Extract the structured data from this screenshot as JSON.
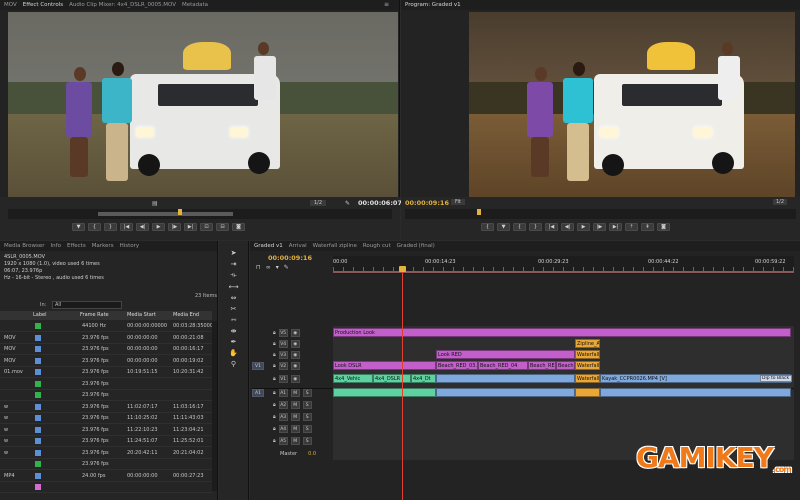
{
  "source_monitor": {
    "tabs": [
      "MOV",
      "Effect Controls",
      "Audio Clip Mixer: 4x4_DSLR_0005.MOV",
      "Metadata"
    ],
    "fit": "1/2",
    "timecode": "00:00:06:07"
  },
  "program_monitor": {
    "tab": "Program: Graded v1",
    "timecode": "00:00:09:16",
    "fit": "Fit",
    "zoom": "1/2"
  },
  "project": {
    "tabs": [
      "Media Browser",
      "Info",
      "Effects",
      "Markers",
      "History"
    ],
    "info_lines": [
      "4SLR_0005.MOV",
      "1920 x 1080 (1.0), video used 6 times",
      "06:07, 23.976p",
      "Hz - 16-bit - Stereo , audio used 6 times"
    ],
    "in_label": "In:",
    "in_value": "All",
    "item_count": "23 Items",
    "columns": [
      "Label",
      "Frame Rate",
      "Media Start",
      "Media End"
    ],
    "rows": [
      {
        "name": "",
        "color": "#2fb34a",
        "rate": "44100 Hz",
        "start": "00:00:00:00000",
        "end": "00:03:28:35000"
      },
      {
        "name": "MOV",
        "color": "#5b8fd6",
        "rate": "23.976 fps",
        "start": "00:00:00:00",
        "end": "00:00:21:08"
      },
      {
        "name": "MOV",
        "color": "#5b8fd6",
        "rate": "23.976 fps",
        "start": "00:00:00:00",
        "end": "00:00:16:17"
      },
      {
        "name": "MOV",
        "color": "#5b8fd6",
        "rate": "23.976 fps",
        "start": "00:00:00:00",
        "end": "00:00:19:02"
      },
      {
        "name": "01.mov",
        "color": "#5b8fd6",
        "rate": "23.976 fps",
        "start": "10:19:51:15",
        "end": "10:20:31:42"
      },
      {
        "name": "",
        "color": "#2fb34a",
        "rate": "23.976 fps",
        "start": "",
        "end": ""
      },
      {
        "name": "",
        "color": "#2fb34a",
        "rate": "23.976 fps",
        "start": "",
        "end": ""
      },
      {
        "name": "w",
        "color": "#5b8fd6",
        "rate": "23.976 fps",
        "start": "11:02:07:17",
        "end": "11:03:16:17"
      },
      {
        "name": "w",
        "color": "#5b8fd6",
        "rate": "23.976 fps",
        "start": "11:10:25:02",
        "end": "11:11:43:03"
      },
      {
        "name": "w",
        "color": "#5b8fd6",
        "rate": "23.976 fps",
        "start": "11:22:10:23",
        "end": "11:23:04:21"
      },
      {
        "name": "w",
        "color": "#5b8fd6",
        "rate": "23.976 fps",
        "start": "11:24:51:07",
        "end": "11:25:52:01"
      },
      {
        "name": "w",
        "color": "#5b8fd6",
        "rate": "23.976 fps",
        "start": "20:20:42:11",
        "end": "20:21:04:02"
      },
      {
        "name": "",
        "color": "#2fb34a",
        "rate": "23.976 fps",
        "start": "",
        "end": ""
      },
      {
        "name": "MP4",
        "color": "#5b8fd6",
        "rate": "24.00 fps",
        "start": "00:00:00:00",
        "end": "00:00:27:23"
      },
      {
        "name": "",
        "color": "#d36cd0",
        "rate": "",
        "start": "",
        "end": ""
      }
    ]
  },
  "timeline": {
    "tabs": [
      "Graded v1",
      "Arrival",
      "Waterfall zipline",
      "Rough cut",
      "Graded (final)"
    ],
    "timecode": "00:00:09:16",
    "ruler": [
      "00:00",
      "00:00:14:23",
      "00:00:29:23",
      "00:00:44:22",
      "00:00:59:22"
    ],
    "tracks": [
      {
        "src": "",
        "name": "V5"
      },
      {
        "src": "",
        "name": "V4"
      },
      {
        "src": "",
        "name": "V3"
      },
      {
        "src": "V1",
        "name": "V2"
      },
      {
        "src": "",
        "name": "V1"
      },
      {
        "src": "A1",
        "name": "A1"
      },
      {
        "src": "",
        "name": "A2"
      },
      {
        "src": "",
        "name": "A3"
      },
      {
        "src": "",
        "name": "A4"
      },
      {
        "src": "",
        "name": "A5"
      }
    ],
    "master_label": "Master",
    "master_value": "0.0",
    "clips": {
      "production_look": "Production Look",
      "zipline": "Zipline_A",
      "waterfall1": "Waterfall",
      "look_red": "Look RED",
      "look_dslr": "Look DSLR",
      "beach1": "Beach_RED_03..",
      "beach2": "Beach_RED_04",
      "beach3": "Beach_RE",
      "beach4": "Beach_RE",
      "waterfall2": "Waterfall",
      "v1a": "4x4_Vehic",
      "v1b": "4x4_DSLR",
      "v1c": "4x4_Dt",
      "waterfall3": "Waterfall",
      "kayak": "Kayak_CCPR0026.MP4 [V]",
      "dip": "Dip to Black"
    }
  },
  "watermark": {
    "text": "GAMIKEY",
    "suffix": ".com"
  }
}
